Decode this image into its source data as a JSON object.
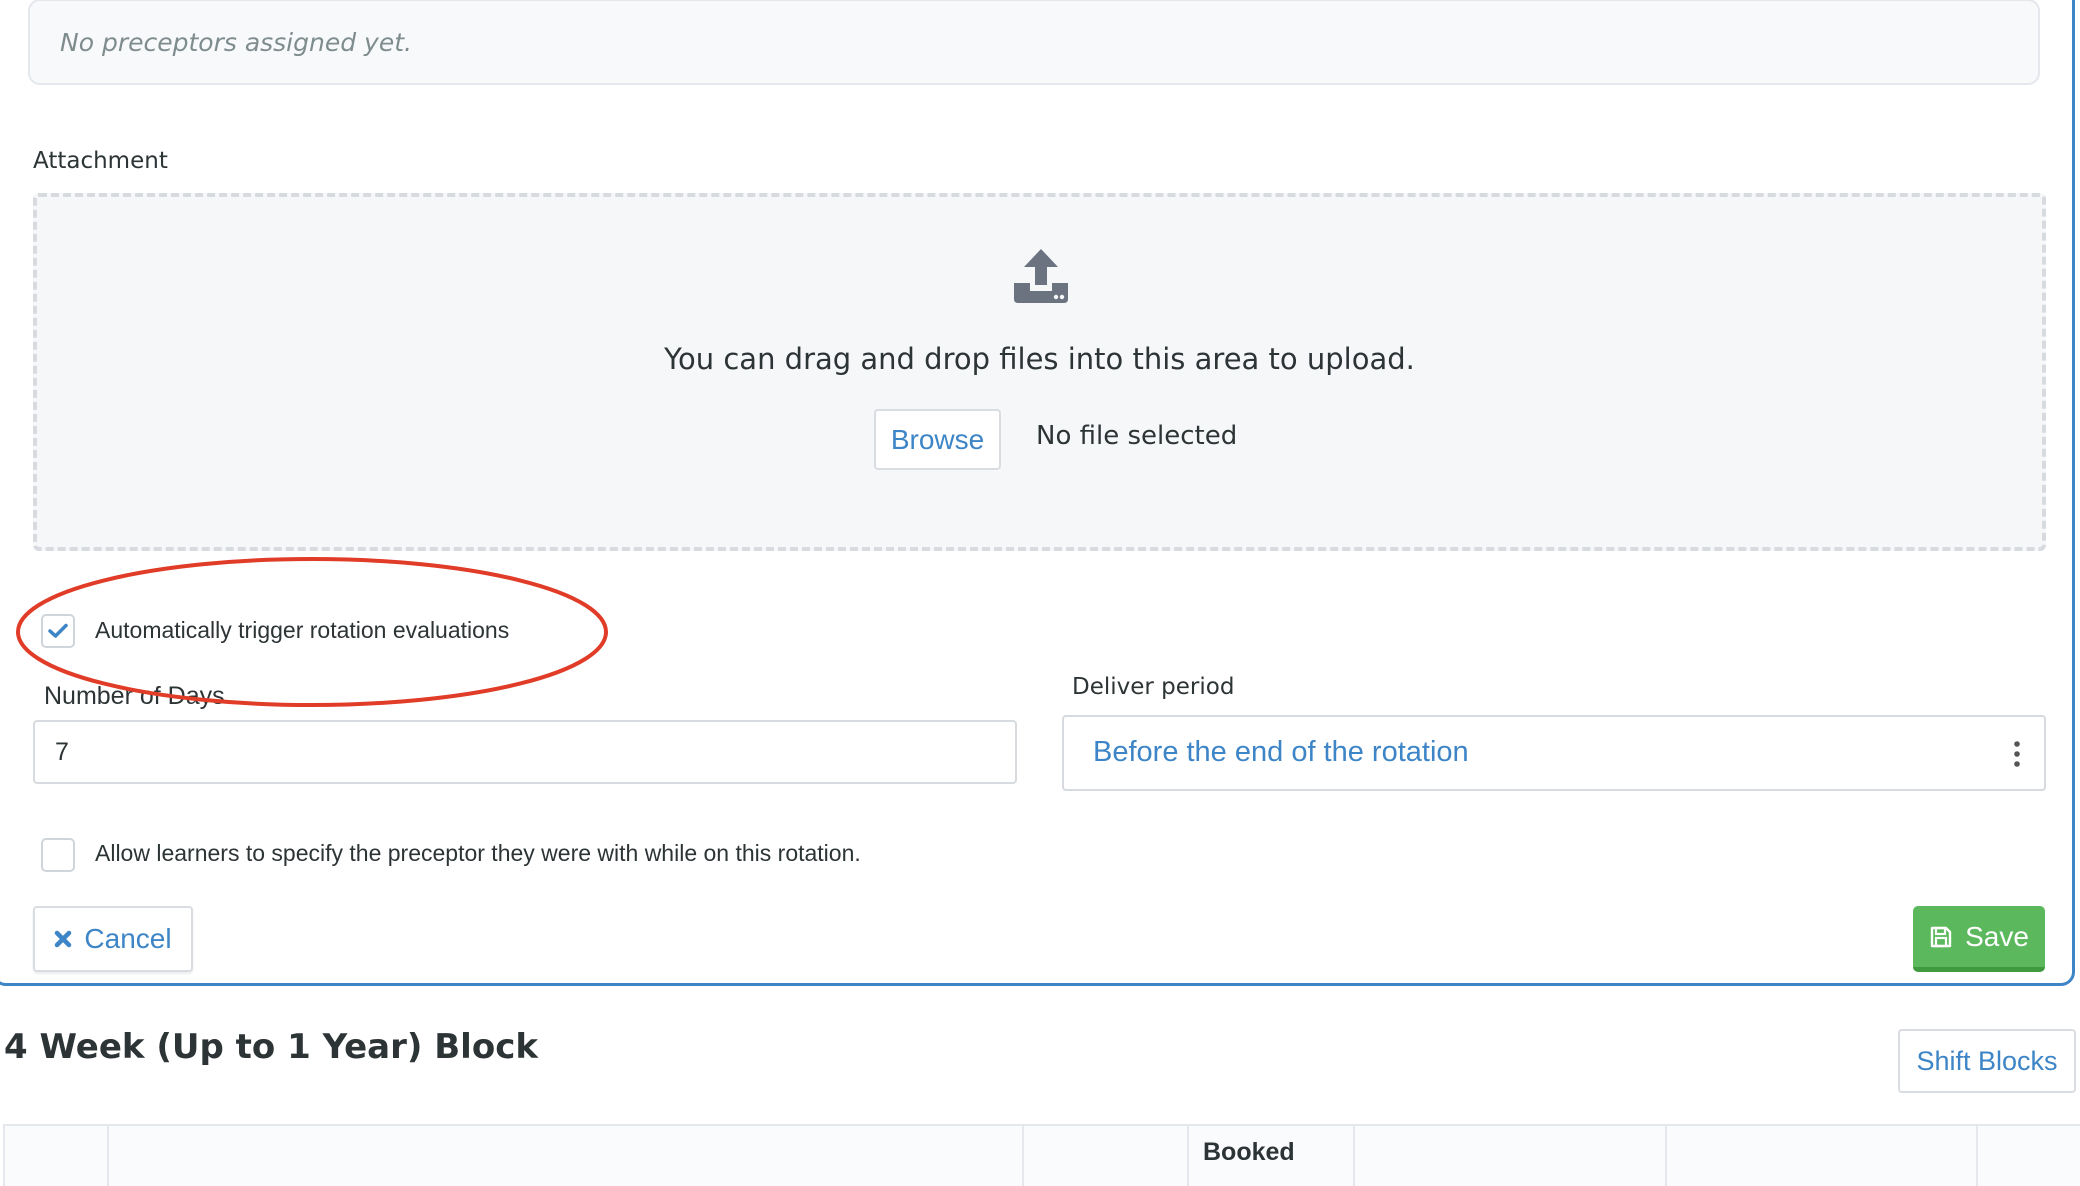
{
  "preceptors": {
    "empty_text": "No preceptors assigned yet."
  },
  "attachment": {
    "label": "Attachment",
    "drop_text": "You can drag and drop files into this area to upload.",
    "browse_label": "Browse",
    "no_file_text": "No file selected",
    "icon": "upload-icon"
  },
  "auto_eval": {
    "label": "Automatically trigger rotation evaluations",
    "checked": true
  },
  "days": {
    "label": "Number of Days",
    "value": "7"
  },
  "deliver": {
    "label": "Deliver period",
    "value": "Before the end of the rotation"
  },
  "allow_preceptor": {
    "label": "Allow learners to specify the preceptor they were with while on this rotation.",
    "checked": false
  },
  "actions": {
    "cancel_label": "Cancel",
    "save_label": "Save"
  },
  "block": {
    "title": "4 Week (Up to 1 Year) Block",
    "shift_label": "Shift Blocks",
    "table_headers": [
      "",
      "",
      "",
      "Booked",
      "",
      "",
      ""
    ]
  },
  "colors": {
    "accent": "#3d85c6",
    "success": "#5cb85c",
    "highlight": "#e03c28"
  }
}
